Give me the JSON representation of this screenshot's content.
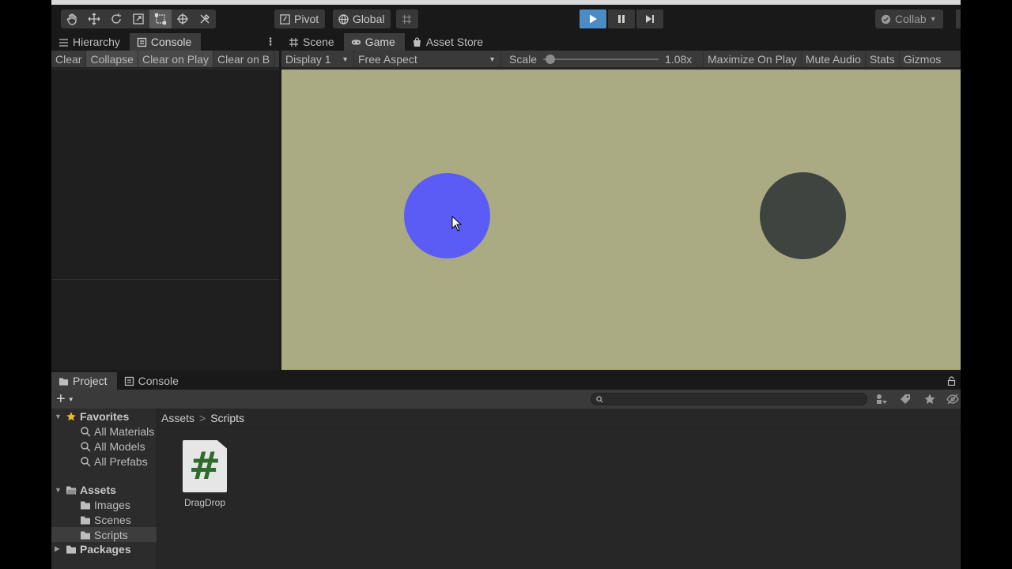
{
  "toolbar": {
    "tools": [
      "hand-icon",
      "move-icon",
      "rotate-icon",
      "scale-icon",
      "rect-icon",
      "transform-icon",
      "custom-tools-icon"
    ],
    "pivot_label": "Pivot",
    "global_label": "Global",
    "collab_label": "Collab",
    "play_state": "playing"
  },
  "left_panel": {
    "tabs": [
      {
        "label": "Hierarchy",
        "icon": "hierarchy-icon"
      },
      {
        "label": "Console",
        "icon": "console-icon",
        "active": true
      }
    ],
    "console_buttons": [
      "Clear",
      "Collapse",
      "Clear on Play",
      "Clear on B"
    ]
  },
  "view_panel": {
    "tabs": [
      {
        "label": "Scene",
        "icon": "scene-icon"
      },
      {
        "label": "Game",
        "icon": "game-icon",
        "active": true
      },
      {
        "label": "Asset Store",
        "icon": "store-icon"
      }
    ],
    "display": "Display 1",
    "aspect": "Free Aspect",
    "scale_label": "Scale",
    "scale_value": "1.08x",
    "scale_fraction": 0.02,
    "options": [
      "Maximize On Play",
      "Mute Audio",
      "Stats",
      "Gizmos"
    ]
  },
  "game": {
    "background": "#aaab82",
    "circles": [
      {
        "name": "draggable",
        "color": "#5a5cf5"
      },
      {
        "name": "target",
        "color": "#3f4440"
      }
    ]
  },
  "project_panel": {
    "tabs": [
      {
        "label": "Project",
        "icon": "folder-icon",
        "active": true
      },
      {
        "label": "Console",
        "icon": "console-icon"
      }
    ],
    "favorites_label": "Favorites",
    "favorites": [
      "All Materials",
      "All Models",
      "All Prefabs"
    ],
    "assets_label": "Assets",
    "asset_folders": [
      "Images",
      "Scenes",
      "Scripts"
    ],
    "selected_folder": "Scripts",
    "packages_label": "Packages",
    "breadcrumb": [
      "Assets",
      "Scripts"
    ],
    "files": [
      {
        "name": "DragDrop",
        "icon": "csharp-script-icon",
        "glyph": "#"
      }
    ]
  }
}
